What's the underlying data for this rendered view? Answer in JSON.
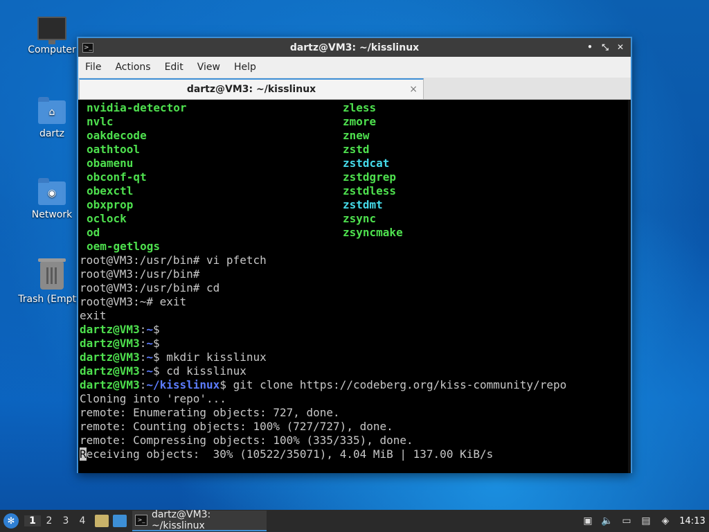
{
  "desktop": {
    "icons": [
      {
        "label": "Computer"
      },
      {
        "label": "dartz"
      },
      {
        "label": "Network"
      },
      {
        "label": "Trash (Empty)"
      }
    ]
  },
  "window": {
    "title": "dartz@VM3: ~/kisslinux",
    "menu": [
      "File",
      "Actions",
      "Edit",
      "View",
      "Help"
    ],
    "tab_title": "dartz@VM3: ~/kisslinux",
    "tab_close": "×",
    "controls": {
      "minimize": "•",
      "maximize": "⤡",
      "close": "✕"
    }
  },
  "terminal": {
    "listing": [
      {
        "left": "nvidia-detector",
        "right": "zless",
        "right_color": "green"
      },
      {
        "left": "nvlc",
        "right": "zmore",
        "right_color": "green"
      },
      {
        "left": "oakdecode",
        "right": "znew",
        "right_color": "green"
      },
      {
        "left": "oathtool",
        "right": "zstd",
        "right_color": "green"
      },
      {
        "left": "obamenu",
        "right": "zstdcat",
        "right_color": "cyan"
      },
      {
        "left": "obconf-qt",
        "right": "zstdgrep",
        "right_color": "green"
      },
      {
        "left": "obexctl",
        "right": "zstdless",
        "right_color": "green"
      },
      {
        "left": "obxprop",
        "right": "zstdmt",
        "right_color": "cyan"
      },
      {
        "left": "oclock",
        "right": "zsync",
        "right_color": "green"
      },
      {
        "left": "od",
        "right": "zsyncmake",
        "right_color": "green"
      },
      {
        "left": "oem-getlogs",
        "right": "",
        "right_color": "green"
      }
    ],
    "root_lines": [
      "root@VM3:/usr/bin# vi pfetch",
      "root@VM3:/usr/bin#",
      "root@VM3:/usr/bin# cd",
      "root@VM3:~# exit",
      "exit"
    ],
    "user_prompt": "dartz@VM3",
    "home_path": "~",
    "kiss_path": "~/kisslinux",
    "user_cmds": [
      "",
      "",
      " mkdir kisslinux",
      " cd kisslinux"
    ],
    "clone_cmd": " git clone https://codeberg.org/kiss-community/repo",
    "output": [
      "Cloning into 'repo'...",
      "remote: Enumerating objects: 727, done.",
      "remote: Counting objects: 100% (727/727), done.",
      "remote: Compressing objects: 100% (335/335), done."
    ],
    "progress_first_char": "R",
    "progress_rest": "eceiving objects:  30% (10522/35071), 4.04 MiB | 137.00 KiB/s"
  },
  "taskbar": {
    "workspaces": [
      "1",
      "2",
      "3",
      "4"
    ],
    "active_workspace": "1",
    "task_title": "dartz@VM3: ~/kisslinux",
    "clock": "14:13"
  }
}
